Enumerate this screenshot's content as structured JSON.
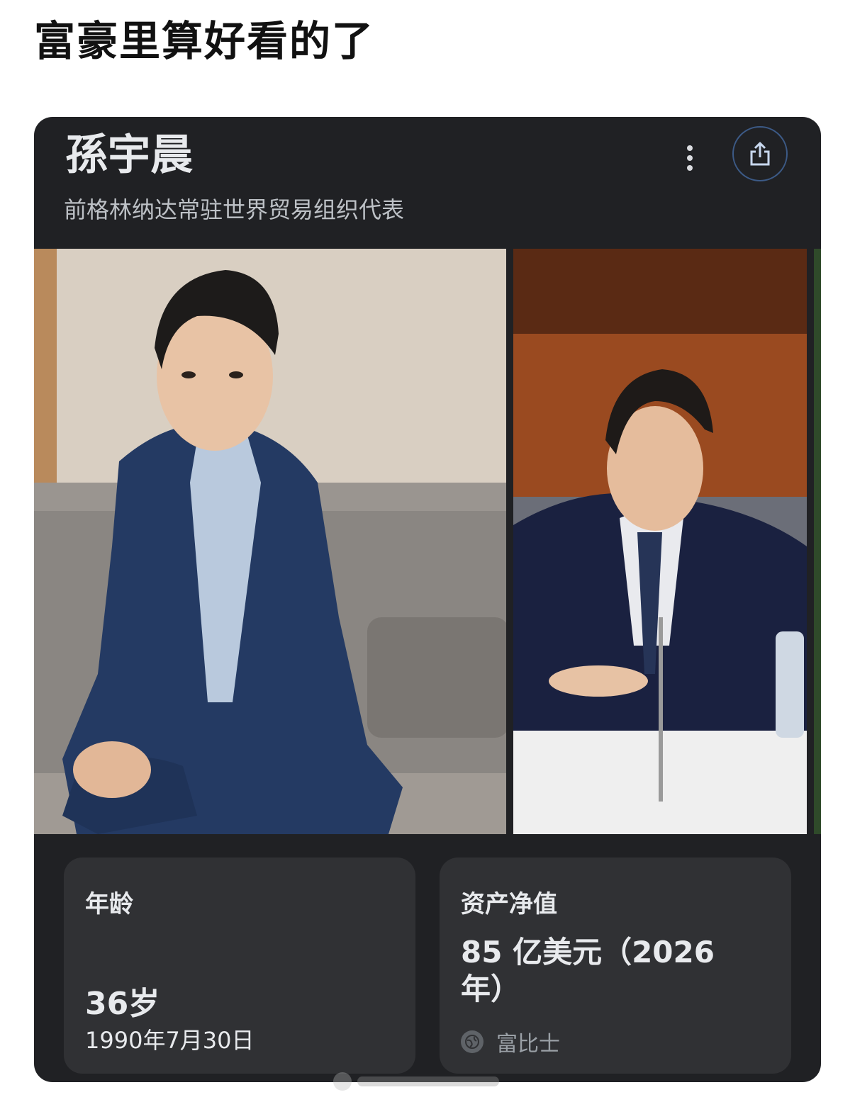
{
  "post": {
    "caption": "富豪里算好看的了"
  },
  "knowledge_panel": {
    "name": "孫宇晨",
    "subtitle": "前格林纳达常驻世界贸易组织代表",
    "more_icon": "more-vert-icon",
    "share_icon": "share-icon",
    "age": {
      "label": "年龄",
      "value": "36岁",
      "birth_date": "1990年7月30日"
    },
    "net_worth": {
      "label": "资产净值",
      "value": "85 亿美元（2026年）",
      "source": "富比士",
      "source_icon": "globe-icon"
    },
    "colors": {
      "card_bg": "#202124",
      "tile_bg": "#303134",
      "text_primary": "#e8eaed",
      "text_secondary": "#bdc1c6",
      "share_border": "#3c5a86"
    }
  }
}
